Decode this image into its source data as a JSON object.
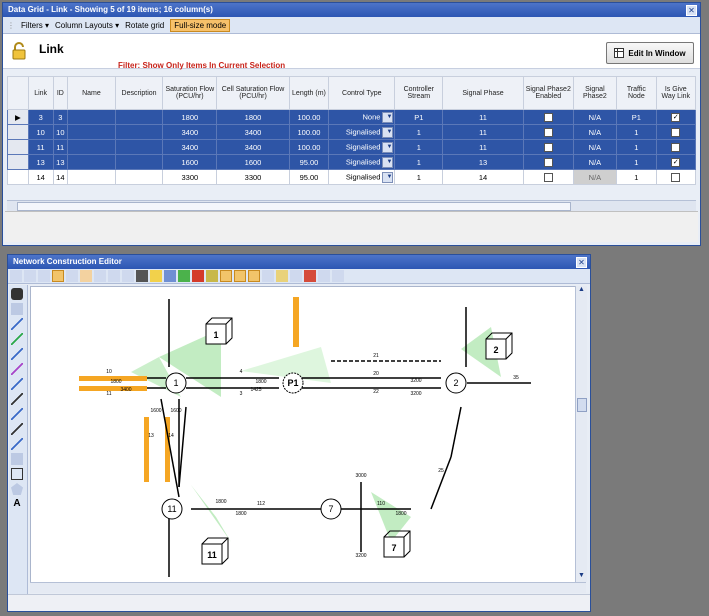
{
  "grid_window": {
    "title": "Data Grid - Link - Showing 5 of 19 items;  16 column(s)",
    "toolbar": {
      "filters": "Filters",
      "column_layouts": "Column Layouts",
      "rotate_grid": "Rotate grid",
      "full_size": "Full-size mode"
    },
    "heading": "Link",
    "filter_text": "Filter:  Show Only Items In Current Selection",
    "edit_button": "Edit In Window",
    "columns": [
      "Link",
      "ID",
      "Name",
      "Description",
      "Saturation Flow (PCU/hr)",
      "Cell Saturation Flow (PCU/hr)",
      "Length (m)",
      "Control Type",
      "Controller Stream",
      "Signal Phase",
      "Signal Phase2 Enabled",
      "Signal Phase2",
      "Traffic Node",
      "Is Give Way Link"
    ],
    "rows": [
      {
        "link": "3",
        "id": "3",
        "name": "",
        "desc": "",
        "sat": "1800",
        "cell": "1800",
        "len": "100.00",
        "ctrl": "None",
        "stream": "P1",
        "phase": "11",
        "p2en": false,
        "p2": "N/A",
        "node": "P1",
        "giveway": true,
        "selected": true
      },
      {
        "link": "10",
        "id": "10",
        "name": "",
        "desc": "",
        "sat": "3400",
        "cell": "3400",
        "len": "100.00",
        "ctrl": "Signalised",
        "stream": "1",
        "phase": "11",
        "p2en": false,
        "p2": "N/A",
        "node": "1",
        "giveway": false,
        "selected": true
      },
      {
        "link": "11",
        "id": "11",
        "name": "",
        "desc": "",
        "sat": "3400",
        "cell": "3400",
        "len": "100.00",
        "ctrl": "Signalised",
        "stream": "1",
        "phase": "11",
        "p2en": false,
        "p2": "N/A",
        "node": "1",
        "giveway": false,
        "selected": true
      },
      {
        "link": "13",
        "id": "13",
        "name": "",
        "desc": "",
        "sat": "1600",
        "cell": "1600",
        "len": "95.00",
        "ctrl": "Signalised",
        "stream": "1",
        "phase": "13",
        "p2en": false,
        "p2": "N/A",
        "node": "1",
        "giveway": true,
        "selected": true
      },
      {
        "link": "14",
        "id": "14",
        "name": "",
        "desc": "",
        "sat": "3300",
        "cell": "3300",
        "len": "95.00",
        "ctrl": "Signalised",
        "stream": "1",
        "phase": "14",
        "p2en": false,
        "p2": "N/A",
        "node": "1",
        "giveway": false,
        "selected": false
      }
    ]
  },
  "network_window": {
    "title": "Network Construction Editor",
    "nodes": [
      {
        "label": "1"
      },
      {
        "label": "2"
      },
      {
        "label": "P1"
      },
      {
        "label": "11"
      },
      {
        "label": "7"
      }
    ],
    "boxes": [
      {
        "label": "1"
      },
      {
        "label": "2"
      },
      {
        "label": "11"
      },
      {
        "label": "7"
      }
    ],
    "link_labels": [
      "10",
      "11",
      "4",
      "3",
      "21",
      "20",
      "22",
      "35",
      "13",
      "14",
      "112",
      "110",
      "25",
      "1800",
      "1425",
      "3400",
      "3200",
      "3200",
      "1600",
      "1600",
      "1800",
      "1800",
      "1800",
      "1800",
      "3000",
      "3200"
    ]
  },
  "colors": {
    "title_bar": "#2c56b3",
    "selection": "#2e55a6",
    "filter_text": "#c8241b",
    "highlight_link": "#f5a623",
    "green": "#3cb043"
  }
}
